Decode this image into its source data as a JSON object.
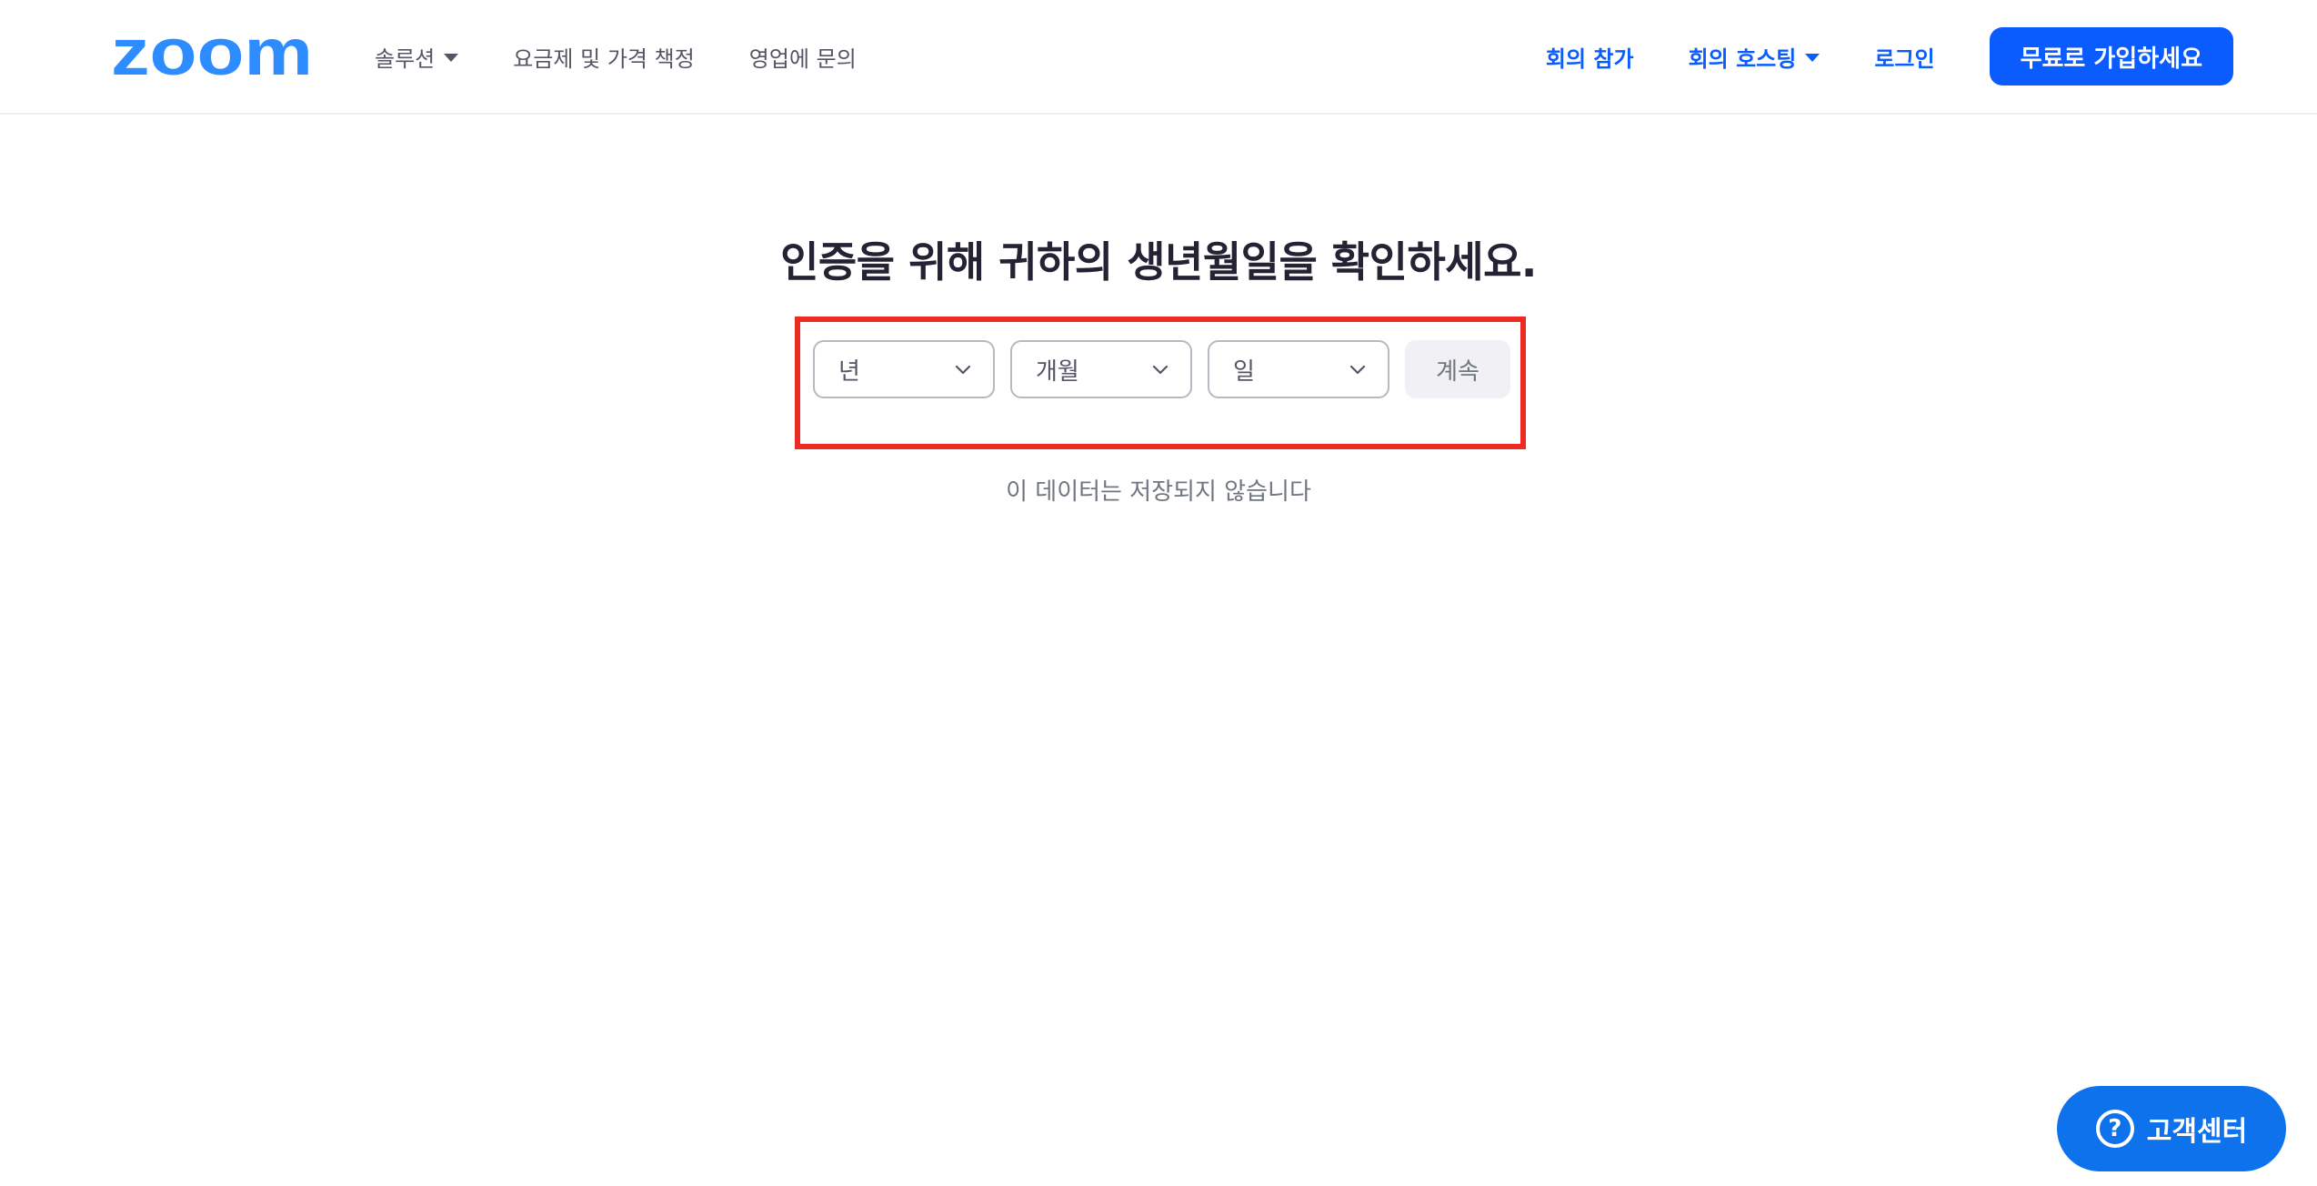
{
  "header": {
    "logo_text": "zoom",
    "nav_left": [
      {
        "label": "솔루션",
        "has_dropdown": true
      },
      {
        "label": "요금제 및 가격 책정",
        "has_dropdown": false
      },
      {
        "label": "영업에 문의",
        "has_dropdown": false
      }
    ],
    "nav_right": [
      {
        "label": "회의 참가",
        "has_dropdown": false
      },
      {
        "label": "회의 호스팅",
        "has_dropdown": true
      },
      {
        "label": "로그인",
        "has_dropdown": false
      }
    ],
    "signup_label": "무료로 가입하세요"
  },
  "main": {
    "title": "인증을 위해 귀하의 생년월일을 확인하세요.",
    "selects": {
      "year": "년",
      "month": "개월",
      "day": "일"
    },
    "continue_label": "계속",
    "note": "이 데이터는 저장되지 않습니다"
  },
  "help": {
    "label": "고객센터",
    "icon_glyph": "?"
  },
  "colors": {
    "brand": "#0b5cff",
    "logo": "#2d8cff",
    "highlight_border": "#ee2b22",
    "help_bg": "#0e72ed"
  }
}
